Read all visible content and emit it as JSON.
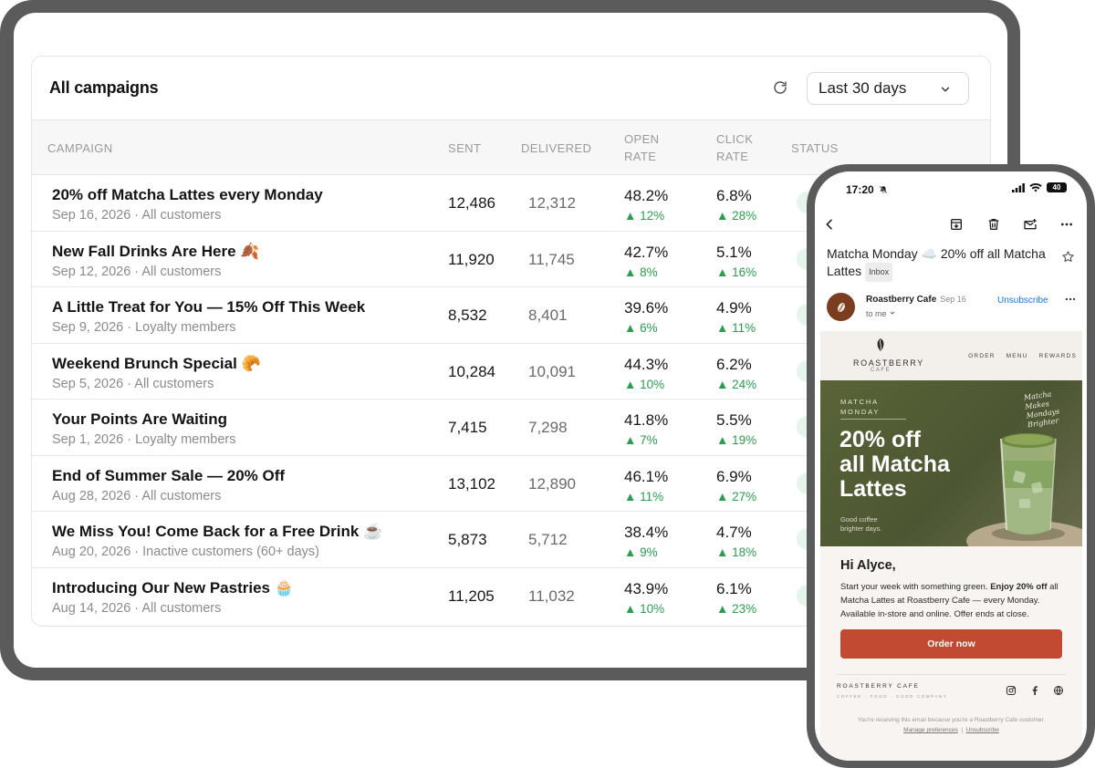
{
  "dashboard": {
    "title": "All campaigns",
    "date_range": "Last 30 days",
    "columns": {
      "campaign": "CAMPAIGN",
      "sent": "SENT",
      "delivered": "DELIVERED",
      "open_rate": [
        "OPEN",
        "RATE"
      ],
      "click_rate": [
        "CLICK",
        "RATE"
      ],
      "status": "STATUS"
    },
    "rows": [
      {
        "name": "20% off Matcha Lattes every Monday",
        "meta": "Sep 16, 2026 · All customers",
        "sent": "12,486",
        "delivered": "12,312",
        "open": "48.2%",
        "open_delta": "▲ 12%",
        "click": "6.8%",
        "click_delta": "▲ 28%"
      },
      {
        "name": "New Fall Drinks Are Here 🍂",
        "meta": "Sep 12, 2026 · All customers",
        "sent": "11,920",
        "delivered": "11,745",
        "open": "42.7%",
        "open_delta": "▲ 8%",
        "click": "5.1%",
        "click_delta": "▲ 16%"
      },
      {
        "name": "A Little Treat for You — 15% Off This Week",
        "meta": "Sep 9, 2026 · Loyalty members",
        "sent": "8,532",
        "delivered": "8,401",
        "open": "39.6%",
        "open_delta": "▲ 6%",
        "click": "4.9%",
        "click_delta": "▲ 11%"
      },
      {
        "name": "Weekend Brunch Special 🥐",
        "meta": "Sep 5, 2026 · All customers",
        "sent": "10,284",
        "delivered": "10,091",
        "open": "44.3%",
        "open_delta": "▲ 10%",
        "click": "6.2%",
        "click_delta": "▲ 24%"
      },
      {
        "name": "Your Points Are Waiting",
        "meta": "Sep 1, 2026 · Loyalty members",
        "sent": "7,415",
        "delivered": "7,298",
        "open": "41.8%",
        "open_delta": "▲ 7%",
        "click": "5.5%",
        "click_delta": "▲ 19%"
      },
      {
        "name": "End of Summer Sale — 20% Off",
        "meta": "Aug 28, 2026 · All customers",
        "sent": "13,102",
        "delivered": "12,890",
        "open": "46.1%",
        "open_delta": "▲ 11%",
        "click": "6.9%",
        "click_delta": "▲ 27%"
      },
      {
        "name": "We Miss You! Come Back for a Free Drink ☕",
        "meta": "Aug 20, 2026 · Inactive customers (60+ days)",
        "sent": "5,873",
        "delivered": "5,712",
        "open": "38.4%",
        "open_delta": "▲ 9%",
        "click": "4.7%",
        "click_delta": "▲ 18%"
      },
      {
        "name": "Introducing Our New Pastries 🧁",
        "meta": "Aug 14, 2026 · All customers",
        "sent": "11,205",
        "delivered": "11,032",
        "open": "43.9%",
        "open_delta": "▲ 10%",
        "click": "6.1%",
        "click_delta": "▲ 23%"
      }
    ]
  },
  "phone": {
    "time": "17:20",
    "battery": "40",
    "subject": "Matcha Monday ☁️ 20% off all Matcha Lattes",
    "inbox_tag": "Inbox",
    "sender": "Roastberry Cafe",
    "sender_date": "Sep 16",
    "to": "to me",
    "unsubscribe": "Unsubscribe",
    "email": {
      "brand": "ROASTBERRY",
      "brand_sub": "CAFE",
      "nav": [
        "ORDER",
        "MENU",
        "REWARDS"
      ],
      "kicker": [
        "MATCHA",
        "MONDAY"
      ],
      "headline": [
        "20% off",
        "all Matcha",
        "Lattes"
      ],
      "hero_sub": [
        "Good coffee",
        "brighter days."
      ],
      "script": [
        "Matcha",
        "Makes",
        "Mondays",
        "Brighter"
      ],
      "greeting": "Hi Alyce,",
      "body_1": "Start your week with something green. ",
      "body_bold": "Enjoy 20% off",
      "body_2": " all Matcha Lattes at Roastberry Cafe — every Monday. Available in-store and online. Offer ends at close.",
      "cta": "Order now",
      "footer_brand": "ROASTBERRY CAFE",
      "footer_tag": "COFFEE · FOOD · GOOD COMPANY",
      "legal": "You're receiving this email because you're a Roastberry Cafe customer.",
      "manage": "Manage preferences",
      "unsubscribe": "Unsubscribe"
    }
  },
  "colors": {
    "positive": "#2a9d4f",
    "cta": "#c24a33",
    "hero": "#4c5632",
    "link": "#1a73e8"
  }
}
